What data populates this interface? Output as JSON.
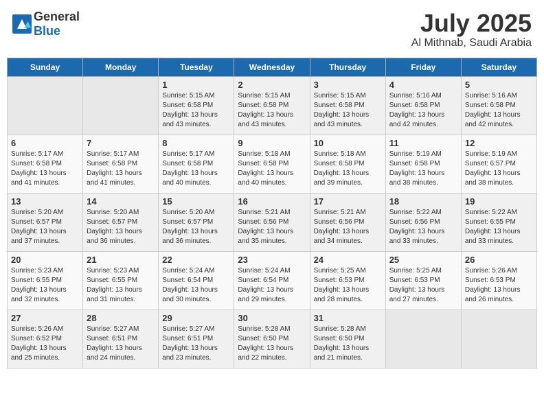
{
  "header": {
    "logo_general": "General",
    "logo_blue": "Blue",
    "month": "July 2025",
    "location": "Al Mithnab, Saudi Arabia"
  },
  "days_of_week": [
    "Sunday",
    "Monday",
    "Tuesday",
    "Wednesday",
    "Thursday",
    "Friday",
    "Saturday"
  ],
  "weeks": [
    [
      {
        "day": "",
        "empty": true
      },
      {
        "day": "",
        "empty": true
      },
      {
        "day": "1",
        "sunrise": "5:15 AM",
        "sunset": "6:58 PM",
        "daylight": "13 hours and 43 minutes."
      },
      {
        "day": "2",
        "sunrise": "5:15 AM",
        "sunset": "6:58 PM",
        "daylight": "13 hours and 43 minutes."
      },
      {
        "day": "3",
        "sunrise": "5:15 AM",
        "sunset": "6:58 PM",
        "daylight": "13 hours and 43 minutes."
      },
      {
        "day": "4",
        "sunrise": "5:16 AM",
        "sunset": "6:58 PM",
        "daylight": "13 hours and 42 minutes."
      },
      {
        "day": "5",
        "sunrise": "5:16 AM",
        "sunset": "6:58 PM",
        "daylight": "13 hours and 42 minutes."
      }
    ],
    [
      {
        "day": "6",
        "sunrise": "5:17 AM",
        "sunset": "6:58 PM",
        "daylight": "13 hours and 41 minutes."
      },
      {
        "day": "7",
        "sunrise": "5:17 AM",
        "sunset": "6:58 PM",
        "daylight": "13 hours and 41 minutes."
      },
      {
        "day": "8",
        "sunrise": "5:17 AM",
        "sunset": "6:58 PM",
        "daylight": "13 hours and 40 minutes."
      },
      {
        "day": "9",
        "sunrise": "5:18 AM",
        "sunset": "6:58 PM",
        "daylight": "13 hours and 40 minutes."
      },
      {
        "day": "10",
        "sunrise": "5:18 AM",
        "sunset": "6:58 PM",
        "daylight": "13 hours and 39 minutes."
      },
      {
        "day": "11",
        "sunrise": "5:19 AM",
        "sunset": "6:58 PM",
        "daylight": "13 hours and 38 minutes."
      },
      {
        "day": "12",
        "sunrise": "5:19 AM",
        "sunset": "6:57 PM",
        "daylight": "13 hours and 38 minutes."
      }
    ],
    [
      {
        "day": "13",
        "sunrise": "5:20 AM",
        "sunset": "6:57 PM",
        "daylight": "13 hours and 37 minutes."
      },
      {
        "day": "14",
        "sunrise": "5:20 AM",
        "sunset": "6:57 PM",
        "daylight": "13 hours and 36 minutes."
      },
      {
        "day": "15",
        "sunrise": "5:20 AM",
        "sunset": "6:57 PM",
        "daylight": "13 hours and 36 minutes."
      },
      {
        "day": "16",
        "sunrise": "5:21 AM",
        "sunset": "6:56 PM",
        "daylight": "13 hours and 35 minutes."
      },
      {
        "day": "17",
        "sunrise": "5:21 AM",
        "sunset": "6:56 PM",
        "daylight": "13 hours and 34 minutes."
      },
      {
        "day": "18",
        "sunrise": "5:22 AM",
        "sunset": "6:56 PM",
        "daylight": "13 hours and 33 minutes."
      },
      {
        "day": "19",
        "sunrise": "5:22 AM",
        "sunset": "6:55 PM",
        "daylight": "13 hours and 33 minutes."
      }
    ],
    [
      {
        "day": "20",
        "sunrise": "5:23 AM",
        "sunset": "6:55 PM",
        "daylight": "13 hours and 32 minutes."
      },
      {
        "day": "21",
        "sunrise": "5:23 AM",
        "sunset": "6:55 PM",
        "daylight": "13 hours and 31 minutes."
      },
      {
        "day": "22",
        "sunrise": "5:24 AM",
        "sunset": "6:54 PM",
        "daylight": "13 hours and 30 minutes."
      },
      {
        "day": "23",
        "sunrise": "5:24 AM",
        "sunset": "6:54 PM",
        "daylight": "13 hours and 29 minutes."
      },
      {
        "day": "24",
        "sunrise": "5:25 AM",
        "sunset": "6:53 PM",
        "daylight": "13 hours and 28 minutes."
      },
      {
        "day": "25",
        "sunrise": "5:25 AM",
        "sunset": "6:53 PM",
        "daylight": "13 hours and 27 minutes."
      },
      {
        "day": "26",
        "sunrise": "5:26 AM",
        "sunset": "6:53 PM",
        "daylight": "13 hours and 26 minutes."
      }
    ],
    [
      {
        "day": "27",
        "sunrise": "5:26 AM",
        "sunset": "6:52 PM",
        "daylight": "13 hours and 25 minutes."
      },
      {
        "day": "28",
        "sunrise": "5:27 AM",
        "sunset": "6:51 PM",
        "daylight": "13 hours and 24 minutes."
      },
      {
        "day": "29",
        "sunrise": "5:27 AM",
        "sunset": "6:51 PM",
        "daylight": "13 hours and 23 minutes."
      },
      {
        "day": "30",
        "sunrise": "5:28 AM",
        "sunset": "6:50 PM",
        "daylight": "13 hours and 22 minutes."
      },
      {
        "day": "31",
        "sunrise": "5:28 AM",
        "sunset": "6:50 PM",
        "daylight": "13 hours and 21 minutes."
      },
      {
        "day": "",
        "empty": true
      },
      {
        "day": "",
        "empty": true
      }
    ]
  ]
}
